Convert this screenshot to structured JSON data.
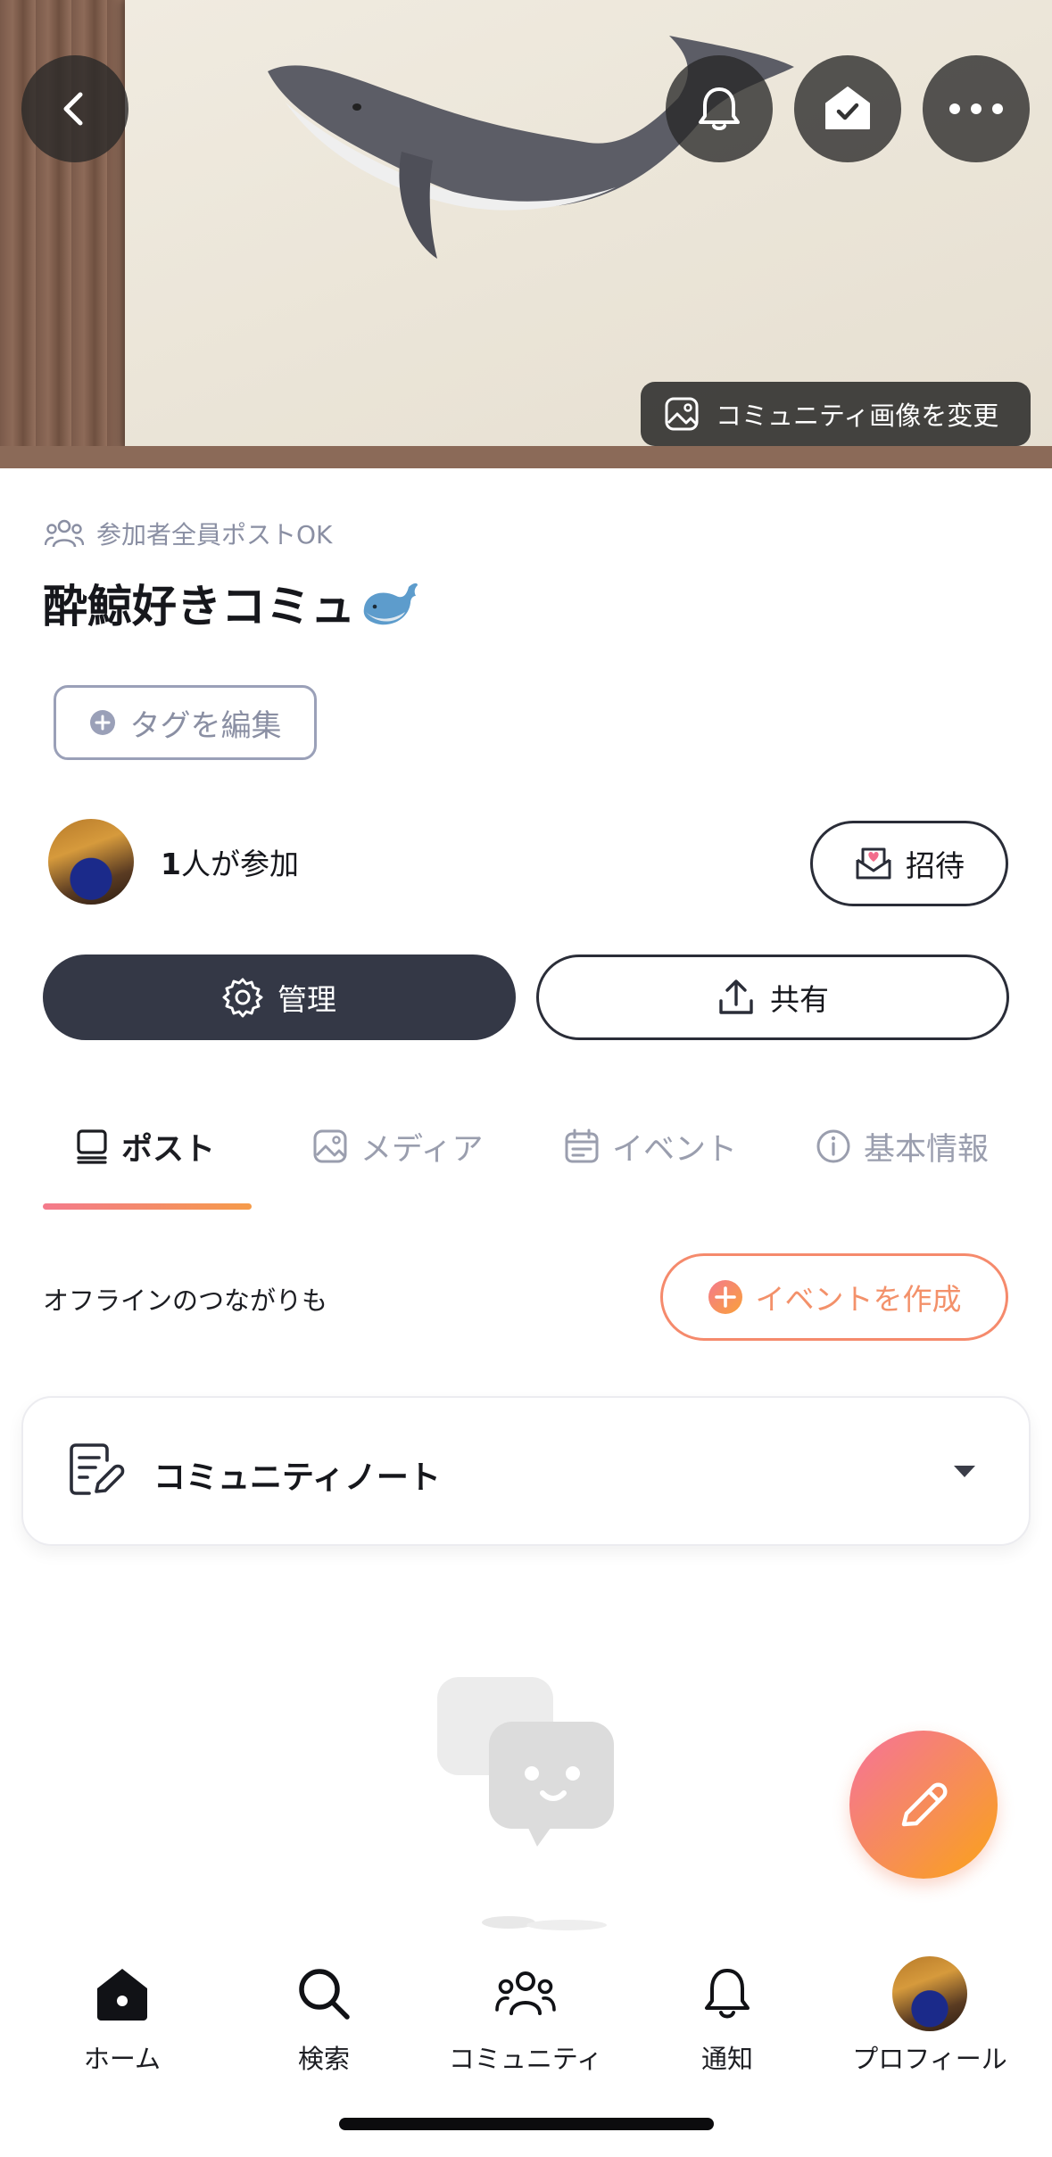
{
  "header": {
    "back_icon": "chevron-left-icon",
    "bell_icon": "bell-icon",
    "home_check_icon": "home-check-icon",
    "more_icon": "more-horizontal-icon",
    "change_image_label": "コミュニティ画像を変更"
  },
  "community": {
    "post_permission": "参加者全員ポストOK",
    "title": "酔鯨好きコミュ",
    "tag_button": "タグを編集",
    "members_count": "1",
    "members_suffix": "人が参加",
    "invite_label": "招待",
    "manage_label": "管理",
    "share_label": "共有"
  },
  "tabs": [
    {
      "label": "ポスト",
      "icon": "post-icon",
      "active": true
    },
    {
      "label": "メディア",
      "icon": "image-icon",
      "active": false
    },
    {
      "label": "イベント",
      "icon": "calendar-icon",
      "active": false
    },
    {
      "label": "基本情報",
      "icon": "info-icon",
      "active": false
    }
  ],
  "offline": {
    "text": "オフラインのつながりも",
    "create_event_label": "イベントを作成"
  },
  "note": {
    "label": "コミュニティノート"
  },
  "bottom_nav": [
    {
      "label": "ホーム",
      "icon": "home-icon"
    },
    {
      "label": "検索",
      "icon": "search-icon"
    },
    {
      "label": "コミュニティ",
      "icon": "community-icon"
    },
    {
      "label": "通知",
      "icon": "bell-icon"
    },
    {
      "label": "プロフィール",
      "icon": "avatar"
    }
  ],
  "colors": {
    "accent_gradient_start": "#f47a8c",
    "accent_gradient_end": "#f59b4a",
    "dark_button": "#343846",
    "muted_text": "#8a8fa3"
  }
}
